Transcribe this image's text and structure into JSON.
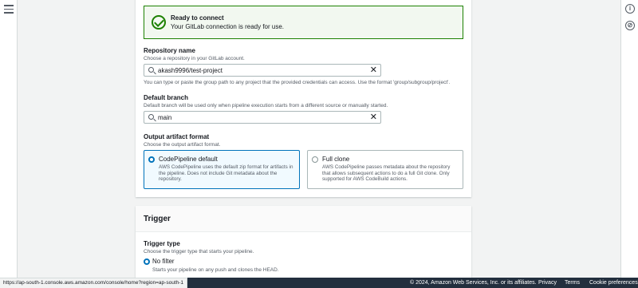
{
  "alert": {
    "title": "Ready to connect",
    "message": "Your GitLab connection is ready for use."
  },
  "repository": {
    "label": "Repository name",
    "description": "Choose a repository in your GitLab account.",
    "value": "akash9996/test-project",
    "hint": "You can type or paste the group path to any project that the provided credentials can access. Use the format 'group/subgroup/project'."
  },
  "branch": {
    "label": "Default branch",
    "description": "Default branch will be used only when pipeline execution starts from a different source or manually started.",
    "value": "main"
  },
  "artifact": {
    "label": "Output artifact format",
    "description": "Choose the output artifact format.",
    "options": [
      {
        "title": "CodePipeline default",
        "description": "AWS CodePipeline uses the default zip format for artifacts in the pipeline. Does not include Git metadata about the repository.",
        "selected": true
      },
      {
        "title": "Full clone",
        "description": "AWS CodePipeline passes metadata about the repository that allows subsequent actions to do a full Git clone. Only supported for AWS CodeBuild actions.",
        "selected": false
      }
    ]
  },
  "trigger": {
    "title": "Trigger",
    "type_label": "Trigger type",
    "type_description": "Choose the trigger type that starts your pipeline.",
    "option_title": "No filter",
    "option_description": "Starts your pipeline on any push and clones the HEAD."
  },
  "status_url": "https://ap-south-1.console.aws.amazon.com/console/home?region=ap-south-1",
  "footer": {
    "copyright": "© 2024, Amazon Web Services, Inc. or its affiliates.",
    "privacy": "Privacy",
    "terms": "Terms",
    "cookies": "Cookie preferences"
  },
  "colors": {
    "accent": "#0073bb",
    "success": "#1d8102",
    "footer_bg": "#232f3e"
  },
  "icons": [
    "menu-icon",
    "info-icon",
    "settings-icon",
    "check-circle-icon",
    "search-icon",
    "close-icon"
  ]
}
